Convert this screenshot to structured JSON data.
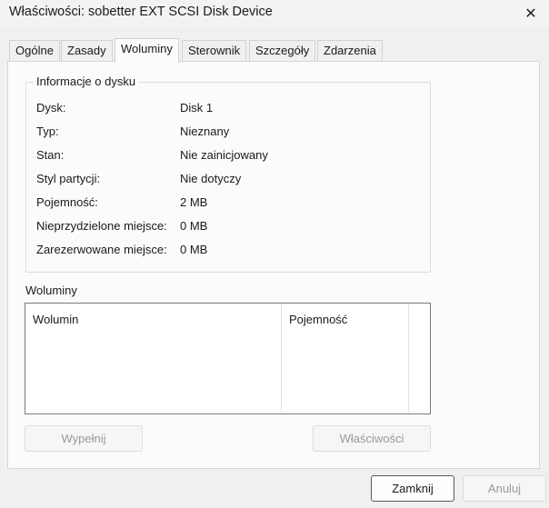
{
  "window": {
    "title": "Właściwości: sobetter EXT SCSI Disk Device"
  },
  "tabs": [
    {
      "label": "Ogólne"
    },
    {
      "label": "Zasady"
    },
    {
      "label": "Woluminy"
    },
    {
      "label": "Sterownik"
    },
    {
      "label": "Szczegóły"
    },
    {
      "label": "Zdarzenia"
    }
  ],
  "disk_info": {
    "legend": "Informacje o dysku",
    "rows": [
      {
        "label": "Dysk:",
        "value": "Disk 1"
      },
      {
        "label": "Typ:",
        "value": "Nieznany"
      },
      {
        "label": "Stan:",
        "value": "Nie zainicjowany"
      },
      {
        "label": "Styl partycji:",
        "value": "Nie dotyczy"
      },
      {
        "label": "Pojemność:",
        "value": "2 MB"
      },
      {
        "label": "Nieprzydzielone miejsce:",
        "value": "0 MB"
      },
      {
        "label": "Zarezerwowane miejsce:",
        "value": "0 MB"
      }
    ]
  },
  "volumes": {
    "heading": "Woluminy",
    "columns": [
      "Wolumin",
      "Pojemność"
    ]
  },
  "buttons": {
    "populate": "Wypełnij",
    "properties": "Właściwości",
    "close": "Zamknij",
    "cancel": "Anuluj"
  },
  "icons": {
    "close": "close-icon"
  }
}
